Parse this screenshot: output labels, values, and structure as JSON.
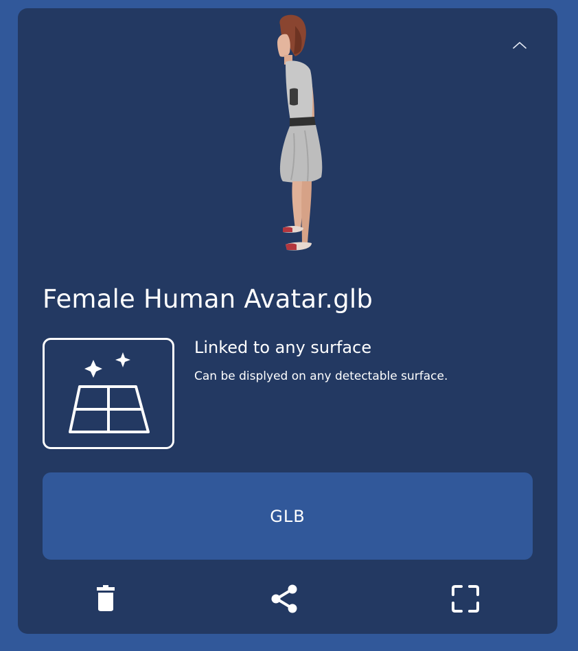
{
  "model": {
    "title": "Female Human Avatar.glb",
    "preview_alt": "Female human avatar 3D model preview"
  },
  "placement": {
    "icon": "surface-sparkle-icon",
    "title": "Linked to any surface",
    "description": "Can be displyed on any detectable surface."
  },
  "format_button": {
    "label": "GLB"
  },
  "actions": {
    "delete_icon": "trash-icon",
    "share_icon": "share-icon",
    "fullscreen_icon": "fullscreen-icon",
    "collapse_icon": "chevron-up-icon"
  },
  "colors": {
    "page_background": "#31589a",
    "card_background": "#233962",
    "button_background": "#31589a",
    "foreground": "#ffffff"
  }
}
